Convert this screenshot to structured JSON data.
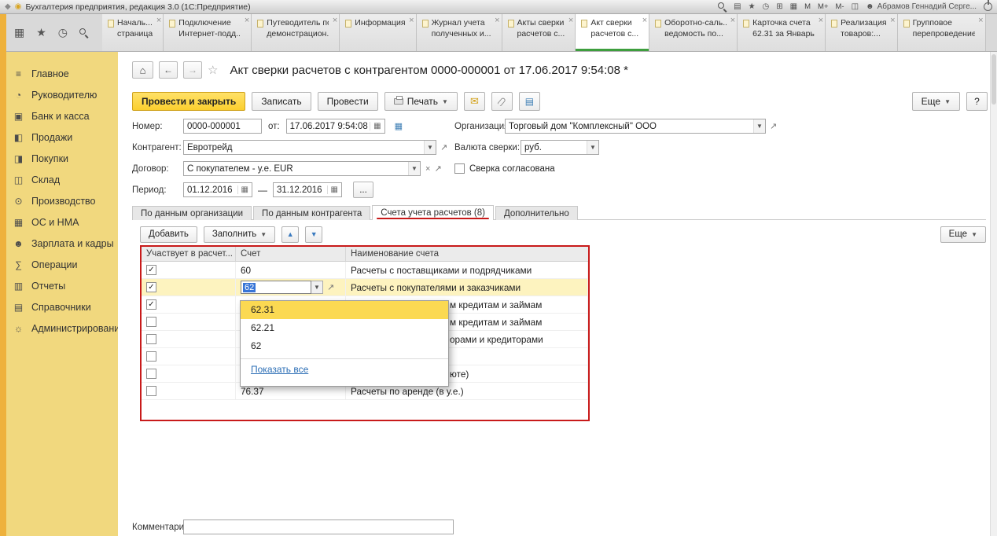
{
  "colors": {
    "accent_yellow": "#fbcf2e",
    "annotation_red": "#c81a1a",
    "active_tab_green": "#3e9e3e",
    "selection_yellow": "#fbd952",
    "selected_row_yellow": "#fdf3bf",
    "sidebar_yellow": "#f1d87e"
  },
  "titlebar": {
    "title": "Бухгалтерия предприятия, редакция 3.0 (1С:Предприятие)",
    "memory_m": "M",
    "memory_mplus": "M+",
    "memory_mminus": "M-",
    "user": "Абрамов Геннадий Серге..."
  },
  "tabbar": {
    "tabs": [
      {
        "line1": "Началь...",
        "line2": "страница",
        "active": false
      },
      {
        "line1": "Подключение",
        "line2": "Интернет-подд...",
        "active": false
      },
      {
        "line1": "Путеводитель по",
        "line2": "демонстрацион...",
        "active": false
      },
      {
        "line1": "Информация",
        "line2": "",
        "active": false
      },
      {
        "line1": "Журнал учета",
        "line2": "полученных и...",
        "active": false
      },
      {
        "line1": "Акты сверки",
        "line2": "расчетов с...",
        "active": false
      },
      {
        "line1": "Акт сверки",
        "line2": "расчетов с...",
        "active": true
      },
      {
        "line1": "Оборотно-саль...",
        "line2": "ведомость по...",
        "active": false
      },
      {
        "line1": "Карточка счета",
        "line2": "62.31 за Январь...",
        "active": false
      },
      {
        "line1": "Реализация",
        "line2": "товаров:...",
        "active": false
      },
      {
        "line1": "Групповое",
        "line2": "перепроведение:",
        "active": false
      }
    ]
  },
  "sidebar": {
    "items": [
      {
        "key": "main",
        "icon": "menu",
        "label": "Главное"
      },
      {
        "key": "manager",
        "icon": "chart",
        "label": "Руководителю"
      },
      {
        "key": "bank-cash",
        "icon": "bank",
        "label": "Банк и касса"
      },
      {
        "key": "sales",
        "icon": "sales",
        "label": "Продажи"
      },
      {
        "key": "purchases",
        "icon": "purchases",
        "label": "Покупки"
      },
      {
        "key": "warehouse",
        "icon": "warehouse",
        "label": "Склад"
      },
      {
        "key": "production",
        "icon": "production",
        "label": "Производство"
      },
      {
        "key": "fixed-assets",
        "icon": "assets",
        "label": "ОС и НМА"
      },
      {
        "key": "payroll",
        "icon": "people",
        "label": "Зарплата и кадры"
      },
      {
        "key": "operations",
        "icon": "operations",
        "label": "Операции"
      },
      {
        "key": "reports",
        "icon": "reports",
        "label": "Отчеты"
      },
      {
        "key": "catalogs",
        "icon": "catalogs",
        "label": "Справочники"
      },
      {
        "key": "administration",
        "icon": "admin",
        "label": "Администрирование"
      }
    ]
  },
  "main": {
    "doc_title": "Акт сверки расчетов с контрагентом 0000-000001 от 17.06.2017 9:54:08 *",
    "toolbar": {
      "post_close": "Провести и закрыть",
      "save": "Записать",
      "post": "Провести",
      "print": "Печать",
      "more": "Еще",
      "help": "?"
    },
    "fields": {
      "number_label": "Номер:",
      "number_value": "0000-000001",
      "date_label": "от:",
      "date_value": "17.06.2017  9:54:08",
      "org_label": "Организация:",
      "org_value": "Торговый дом \"Комплексный\" ООО",
      "counterparty_label": "Контрагент:",
      "counterparty_value": "Евротрейд",
      "currency_label": "Валюта сверки:",
      "currency_value": "руб.",
      "contract_label": "Договор:",
      "contract_value": "С покупателем - у.е. EUR",
      "agreed_label": "Сверка согласована",
      "agreed_checked": false,
      "period_label": "Период:",
      "period_from": "01.12.2016",
      "period_dash": "—",
      "period_to": "31.12.2016",
      "period_more": "..."
    },
    "inner_tabs": [
      {
        "label": "По данным организации",
        "active": false,
        "annotated": false
      },
      {
        "label": "По данным контрагента",
        "active": false,
        "annotated": false
      },
      {
        "label": "Счета учета расчетов (8)",
        "active": true,
        "annotated": true
      },
      {
        "label": "Дополнительно",
        "active": false,
        "annotated": false
      }
    ],
    "list_toolbar": {
      "add": "Добавить",
      "fill": "Заполнить",
      "more": "Еще"
    },
    "accounts_table": {
      "headers": [
        "Участвует в расчет...",
        "Счет",
        "Наименование счета"
      ],
      "rows": [
        {
          "checked": true,
          "account": "60",
          "name": "Расчеты с поставщиками и подрядчиками",
          "editing": false,
          "selected": false,
          "partial": false
        },
        {
          "checked": true,
          "account": "62",
          "name": "Расчеты с покупателями и заказчиками",
          "editing": true,
          "selected": true,
          "partial": false
        },
        {
          "checked": true,
          "account": "",
          "name": "м кредитам и займам",
          "editing": false,
          "selected": false,
          "partial": true
        },
        {
          "checked": false,
          "account": "",
          "name": "м кредитам и займам",
          "editing": false,
          "selected": false,
          "partial": true
        },
        {
          "checked": false,
          "account": "",
          "name": "орами и кредиторами",
          "editing": false,
          "selected": false,
          "partial": true
        },
        {
          "checked": false,
          "account": "",
          "name": "",
          "editing": false,
          "selected": false,
          "partial": true
        },
        {
          "checked": false,
          "account": "",
          "name": "юте)",
          "editing": false,
          "selected": false,
          "partial": true
        },
        {
          "checked": false,
          "account": "76.37",
          "name": "Расчеты по аренде (в у.е.)",
          "editing": false,
          "selected": false,
          "partial": false
        }
      ]
    },
    "account_dropdown": {
      "items": [
        {
          "label": "62.31",
          "highlighted": true
        },
        {
          "label": "62.21",
          "highlighted": false
        },
        {
          "label": "62",
          "highlighted": false
        }
      ],
      "show_all": "Показать все"
    },
    "comment_label": "Комментарий:"
  }
}
